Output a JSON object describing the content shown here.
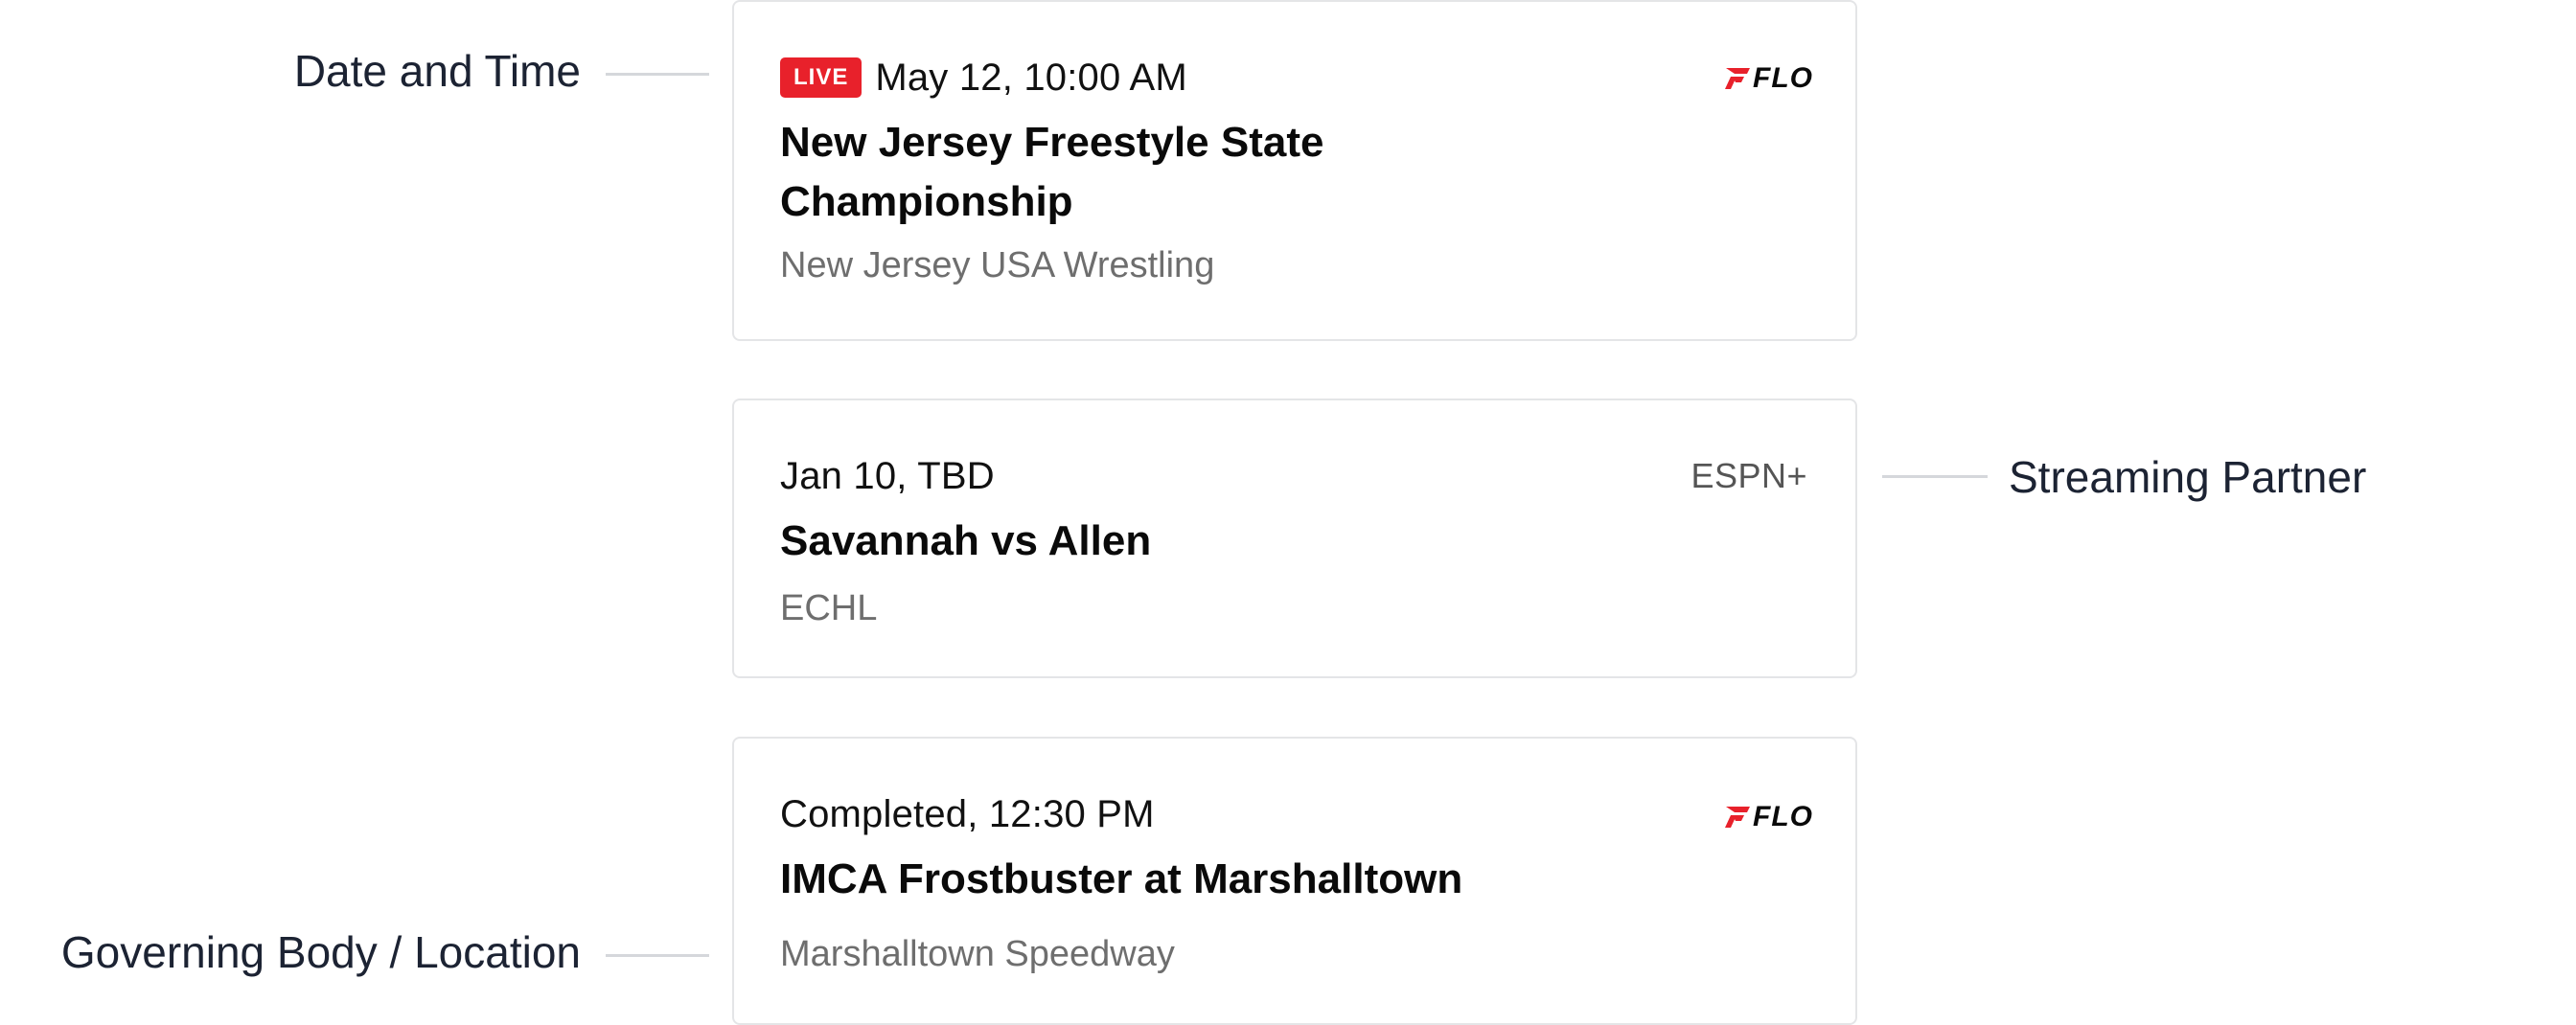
{
  "callouts": {
    "date_time": "Date and Time",
    "streaming_partner": "Streaming Partner",
    "governing_body": "Governing Body / Location"
  },
  "events": [
    {
      "live_badge": "LIVE",
      "date": "May 12, 10:00 AM",
      "title": "New Jersey Freestyle State Championship",
      "subtitle": "New Jersey USA Wrestling",
      "partner_logo": "FLO"
    },
    {
      "date": "Jan 10, TBD",
      "title": "Savannah vs Allen",
      "subtitle": "ECHL",
      "partner_text": "ESPN+"
    },
    {
      "date": "Completed, 12:30 PM",
      "title": "IMCA Frostbuster at Marshalltown",
      "subtitle": "Marshalltown Speedway",
      "partner_logo": "FLO"
    }
  ],
  "colors": {
    "live_red": "#e8212b",
    "flo_red": "#e8212b",
    "card_border": "#e4e5e7",
    "subtitle_gray": "#6e6e6e",
    "callout_text": "#1c2333",
    "callout_line": "#d5d7db"
  },
  "icons": {
    "flo_logo": "flo-logo-icon"
  }
}
